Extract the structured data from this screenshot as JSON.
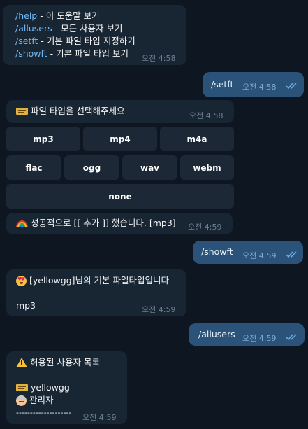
{
  "messages": {
    "help": {
      "lines": [
        {
          "cmd": "/help",
          "text": " - 이 도움말 보기"
        },
        {
          "cmd": "/allusers",
          "text": " - 모든 사용자 보기"
        },
        {
          "cmd": "/setft",
          "text": " - 기본 파일 타입 지정하기"
        },
        {
          "cmd": "/showft",
          "text": " - 기본 파일 타입 보기"
        }
      ],
      "time": "오전 4:58"
    },
    "setft": {
      "text": "/setft",
      "time": "오전 4:58"
    },
    "choose": {
      "icon": "ticket-icon",
      "text": "파일 타입을 선택해주세요",
      "time": "오전 4:58"
    },
    "keyboard": {
      "row1": [
        "mp3",
        "mp4",
        "m4a"
      ],
      "row2": [
        "flac",
        "ogg",
        "wav",
        "webm"
      ],
      "row3": [
        "none"
      ]
    },
    "success": {
      "icon": "rainbow-icon",
      "text": "성공적으로 [[ 추가 ]] 했습니다. [mp3]",
      "time": "오전 4:59"
    },
    "showft": {
      "text": "/showft",
      "time": "오전 4:59"
    },
    "default_type": {
      "icon": "heart-eyes-icon",
      "line1": "[yellowgg]님의 기본 파일타입입니다",
      "line2": "mp3",
      "time": "오전 4:59"
    },
    "allusers": {
      "text": "/allusers",
      "time": "오전 4:59"
    },
    "user_list": {
      "icon": "warning-icon",
      "title": "허용된 사용자 목록",
      "user_name": "yellowgg",
      "user_role": "관리자",
      "separator": "--------------------",
      "time": "오전 4:59"
    }
  },
  "colors": {
    "background": "#0e1621",
    "incoming": "#182533",
    "outgoing": "#2b5278",
    "command": "#71baf6"
  }
}
